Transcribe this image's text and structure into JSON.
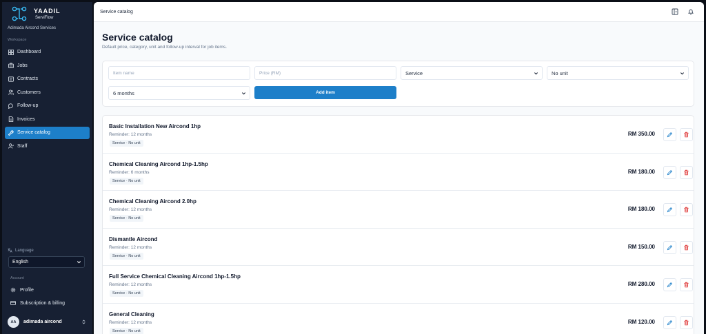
{
  "brand": {
    "name": "YAADIL",
    "product": "ServiFlow"
  },
  "company": "Adimada Aircond Services",
  "sidebar": {
    "workspace_label": "Workspace",
    "items": [
      {
        "label": "Dashboard",
        "icon": "grid-icon",
        "active": false
      },
      {
        "label": "Jobs",
        "icon": "briefcase-icon",
        "active": false
      },
      {
        "label": "Contracts",
        "icon": "contract-icon",
        "active": false
      },
      {
        "label": "Customers",
        "icon": "users-icon",
        "active": false
      },
      {
        "label": "Follow-up",
        "icon": "chat-icon",
        "active": false
      },
      {
        "label": "Invoices",
        "icon": "invoice-icon",
        "active": false
      },
      {
        "label": "Service catalog",
        "icon": "wrench-icon",
        "active": true
      },
      {
        "label": "Staff",
        "icon": "staff-icon",
        "active": false
      }
    ],
    "language_label": "Language",
    "language_value": "English",
    "account_label": "Account",
    "account_items": [
      {
        "label": "Profile",
        "icon": "gear-icon"
      },
      {
        "label": "Subscription & billing",
        "icon": "card-icon"
      }
    ],
    "user": {
      "initials": "AA",
      "name": "adimada aircond"
    }
  },
  "topbar": {
    "breadcrumb": "Service catalog"
  },
  "page": {
    "title": "Service catalog",
    "subtitle": "Default price, category, unit and follow-up interval for job items."
  },
  "form": {
    "item_name_placeholder": "Item name",
    "price_placeholder": "Price (RM)",
    "category_value": "Service",
    "unit_value": "No unit",
    "interval_value": "6 months",
    "add_label": "Add item"
  },
  "items": [
    {
      "name": "Basic Installation New Aircond 1hp",
      "reminder": "Reminder: 12 months",
      "badge": "Service · No unit",
      "price": "RM 350.00"
    },
    {
      "name": "Chemical Cleaning Aircond 1hp-1.5hp",
      "reminder": "Reminder: 6 months",
      "badge": "Service · No unit",
      "price": "RM 180.00"
    },
    {
      "name": "Chemical Cleaning Aircond 2.0hp",
      "reminder": "Reminder: 12 months",
      "badge": "Service · No unit",
      "price": "RM 180.00"
    },
    {
      "name": "Dismantle Aircond",
      "reminder": "Reminder: 12 months",
      "badge": "Service · No unit",
      "price": "RM 150.00"
    },
    {
      "name": "Full Service Chemical Cleaning Aircond 1hp-1.5hp",
      "reminder": "Reminder: 12 months",
      "badge": "Service · No unit",
      "price": "RM 280.00"
    },
    {
      "name": "General Cleaning",
      "reminder": "Reminder: 12 months",
      "badge": "Service · No unit",
      "price": "RM 120.00"
    }
  ],
  "colors": {
    "accent": "#1d7fc9",
    "sidebar": "#172033",
    "danger": "#dc2626"
  }
}
